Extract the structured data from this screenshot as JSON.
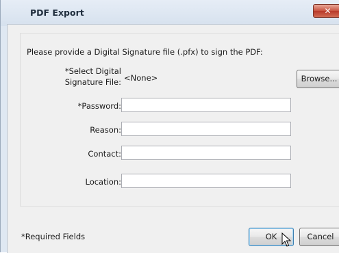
{
  "window": {
    "title": "PDF Export",
    "close_glyph": "✕"
  },
  "instruction": "Please provide a Digital Signature file (.pfx) to sign the PDF:",
  "signature_file": {
    "label_line1": "*Select Digital",
    "label_line2": "Signature File:",
    "value": "<None>",
    "browse_label": "Browse..."
  },
  "fields": {
    "password_label": "*Password:",
    "reason_label": "Reason:",
    "contact_label": "Contact:",
    "location_label": "Location:"
  },
  "footer": {
    "required_note": "*Required Fields",
    "ok_label": "OK",
    "cancel_label": "Cancel"
  },
  "icons": {
    "cursor": "mouse-pointer-icon"
  }
}
